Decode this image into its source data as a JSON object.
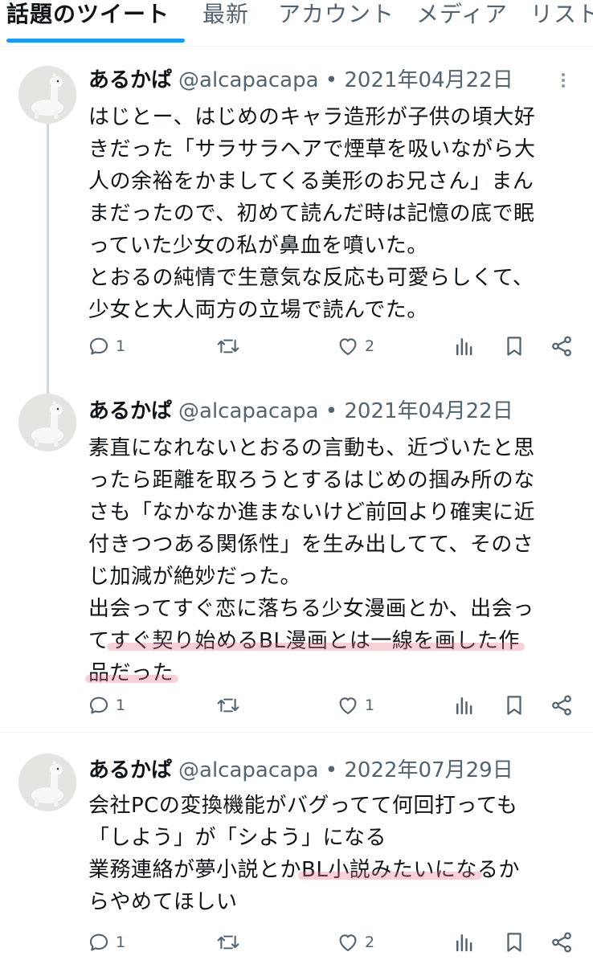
{
  "tabs": [
    {
      "label": "話題のツイート"
    },
    {
      "label": "最新"
    },
    {
      "label": "アカウント"
    },
    {
      "label": "メディア"
    },
    {
      "label": "リスト"
    }
  ],
  "tweets": [
    {
      "name": "あるかぱ",
      "handle": "@alcapacapa • 2021年04月22日",
      "lines": [
        "はじとー、はじめのキャラ造形が子供の頃大好",
        "きだった「サラサラヘアで煙草を吸いながら大",
        "人の余裕をかましてくる美形のお兄さん」まん",
        "まだったので、初めて読んだ時は記憶の底で眠",
        "っていた少女の私が鼻血を噴いた。",
        "とおるの純情で生意気な反応も可愛らしくて、",
        "少女と大人両方の立場で読んでた。"
      ],
      "replies": "1",
      "retweets": "",
      "likes": "2"
    },
    {
      "name": "あるかぱ",
      "handle": "@alcapacapa • 2021年04月22日",
      "lines": [
        "素直になれないとおるの言動も、近づいたと思",
        "ったら距離を取ろうとするはじめの掴み所のな",
        "さも「なかなか進まないけど前回より確実に近",
        "付きつつある関係性」を生み出してて、そのさ",
        "じ加減が絶妙だった。",
        "出会ってすぐ恋に落ちる少女漫画とか、出会っ"
      ],
      "hl1_pre": "て",
      "hl1_text": "すぐ契り始めるBL漫画とは一線を画した作",
      "hl2_text": "品だった",
      "replies": "1",
      "retweets": "",
      "likes": "1"
    },
    {
      "name": "あるかぱ",
      "handle": "@alcapacapa • 2022年07月29日",
      "lines": [
        "会社PCの変換機能がバグってて何回打っても",
        "「しよう」が「シよう」になる"
      ],
      "hl_pre": "業務連絡が夢小説とか",
      "hl_text": "BL小説みたいにな",
      "hl_post": "るか",
      "last_line": "らやめてほしい",
      "replies": "1",
      "retweets": "",
      "likes": "2"
    }
  ],
  "icons": {
    "reply": "reply-icon",
    "retweet": "retweet-icon",
    "like": "heart-icon",
    "views": "views-icon",
    "bookmark": "bookmark-icon",
    "share": "share-icon",
    "more": "more-icon"
  },
  "colors": {
    "accent": "#1d9bf0",
    "text": "#0f1419",
    "muted": "#536471",
    "highlight": "#ec788c"
  }
}
